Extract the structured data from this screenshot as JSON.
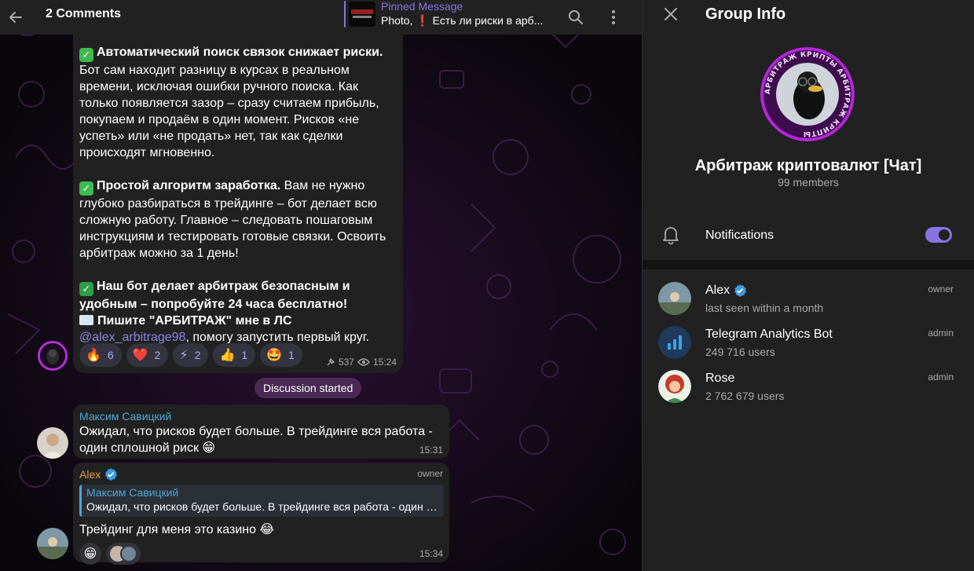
{
  "chat": {
    "header": {
      "title": "2 Comments",
      "pinned_label": "Pinned Message",
      "pinned_preview": "Photo, ❗ Есть ли риски в арб..."
    },
    "post": {
      "paragraphs": [
        {
          "bold": "Автоматический поиск связок снижает риски.",
          "text": "Бот сам находит разницу в курсах в реальном времени, исключая ошибки ручного поиска. Как только появляется зазор – сразу считаем прибыль, покупаем и продаём в один момент. Рисков «не успеть» или «не продать» нет, так как сделки происходят мгновенно."
        },
        {
          "bold": "Простой алгоритм заработка.",
          "text": "Вам не нужно глубоко разбираться в трейдинге – бот делает всю сложную работу. Главное – следовать пошаговым инструкциям и тестировать готовые связки. Освоить арбитраж можно за 1 день!"
        }
      ],
      "closing_bold": "Наш бот делает арбитраж безопасным и удобным – попробуйте 24 часа бесплатно!",
      "cta_bold": "Пишите \"АРБИТРАЖ\" мне в ЛС",
      "cta_link": "@alex_arbitrage98",
      "cta_comma": ",",
      "cta_tail": "помогу запустить первый круг.",
      "reactions": [
        {
          "emoji": "🔥",
          "count": "6"
        },
        {
          "emoji": "❤️",
          "count": "2"
        },
        {
          "emoji": "⚡",
          "count": "2"
        },
        {
          "emoji": "👍",
          "count": "1"
        },
        {
          "emoji": "🤩",
          "count": "1"
        }
      ],
      "views": "537",
      "time": "15:24"
    },
    "discussion_pill": "Discussion started",
    "messages": [
      {
        "author": "Максим Савицкий",
        "author_color": "#4fa6d6",
        "text_line1": "Ожидал, что рисков будет больше. В трейдинге вся работа -",
        "text_line2": "один сплошной риск 😁",
        "time": "15:31"
      },
      {
        "author": "Alex",
        "author_color": "#e59a43",
        "role": "owner",
        "reply_author": "Максим Савицкий",
        "reply_text": "Ожидал, что рисков будет больше. В трейдинге вся работа - один с...",
        "text": "Трейдинг для меня это казино 😂",
        "reaction_emoji": "😁",
        "time": "15:34"
      }
    ]
  },
  "group_info": {
    "title": "Group Info",
    "name": "Арбитраж криптовалют [Чат]",
    "members_count": "99 members",
    "avatar_ring_text": "АРБИТРАЖ КРИПТЫ АРБИТРАЖ КРИПТЫ",
    "notifications_label": "Notifications",
    "notifications_on": true,
    "members": [
      {
        "name": "Alex",
        "status": "last seen within a month",
        "role": "owner",
        "verified": true
      },
      {
        "name": "Telegram Analytics Bot",
        "status": "249 716 users",
        "role": "admin",
        "verified": false
      },
      {
        "name": "Rose",
        "status": "2 762 679 users",
        "role": "admin",
        "verified": false
      }
    ]
  },
  "colors": {
    "accent": "#8774e1",
    "bubble": "#212121",
    "panel": "#212121",
    "link": "#8e84e8",
    "reaction_bg": "#343340"
  }
}
